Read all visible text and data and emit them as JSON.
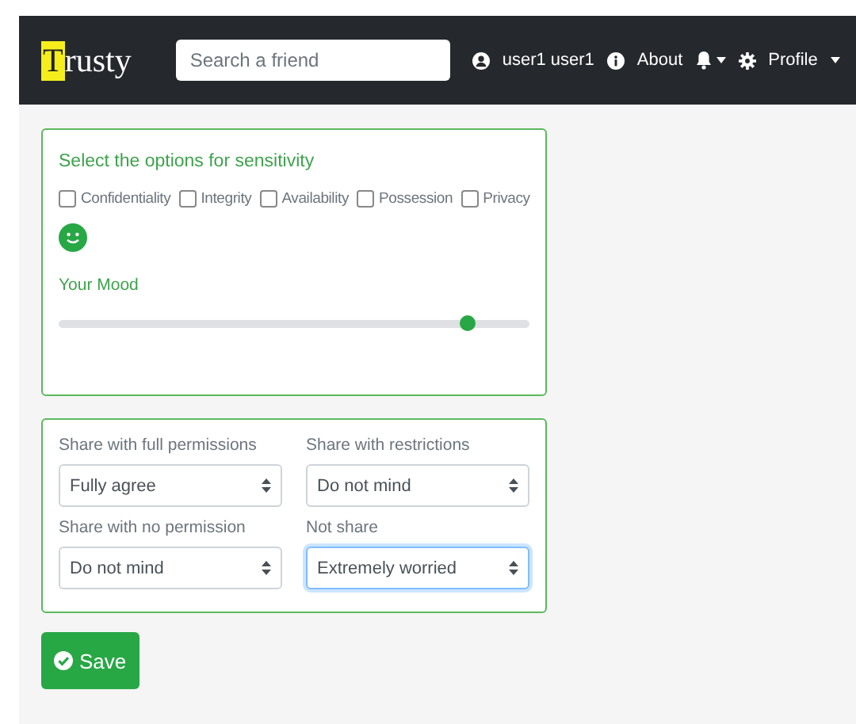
{
  "navbar": {
    "brand_initial": "T",
    "brand_rest": "rusty",
    "search": {
      "placeholder": "Search a friend"
    },
    "user": "user1 user1",
    "about": "About",
    "profile": "Profile"
  },
  "sensitivity": {
    "title": "Select the options for sensitivity",
    "options": [
      {
        "label": "Confidentiality",
        "checked": false
      },
      {
        "label": "Integrity",
        "checked": false
      },
      {
        "label": "Availability",
        "checked": false
      },
      {
        "label": "Possession",
        "checked": false
      },
      {
        "label": "Privacy",
        "checked": false
      }
    ],
    "mood_label": "Your Mood",
    "mood": {
      "level": 0.87
    }
  },
  "sharing": [
    {
      "label": "Share with full permissions",
      "value": "Fully agree",
      "focused": false
    },
    {
      "label": "Share with restrictions",
      "value": "Do not mind",
      "focused": false
    },
    {
      "label": "Share with no permission",
      "value": "Do not mind",
      "focused": false
    },
    {
      "label": "Not share",
      "value": "Extremely worried",
      "focused": true
    }
  ],
  "save_button": "Save"
}
